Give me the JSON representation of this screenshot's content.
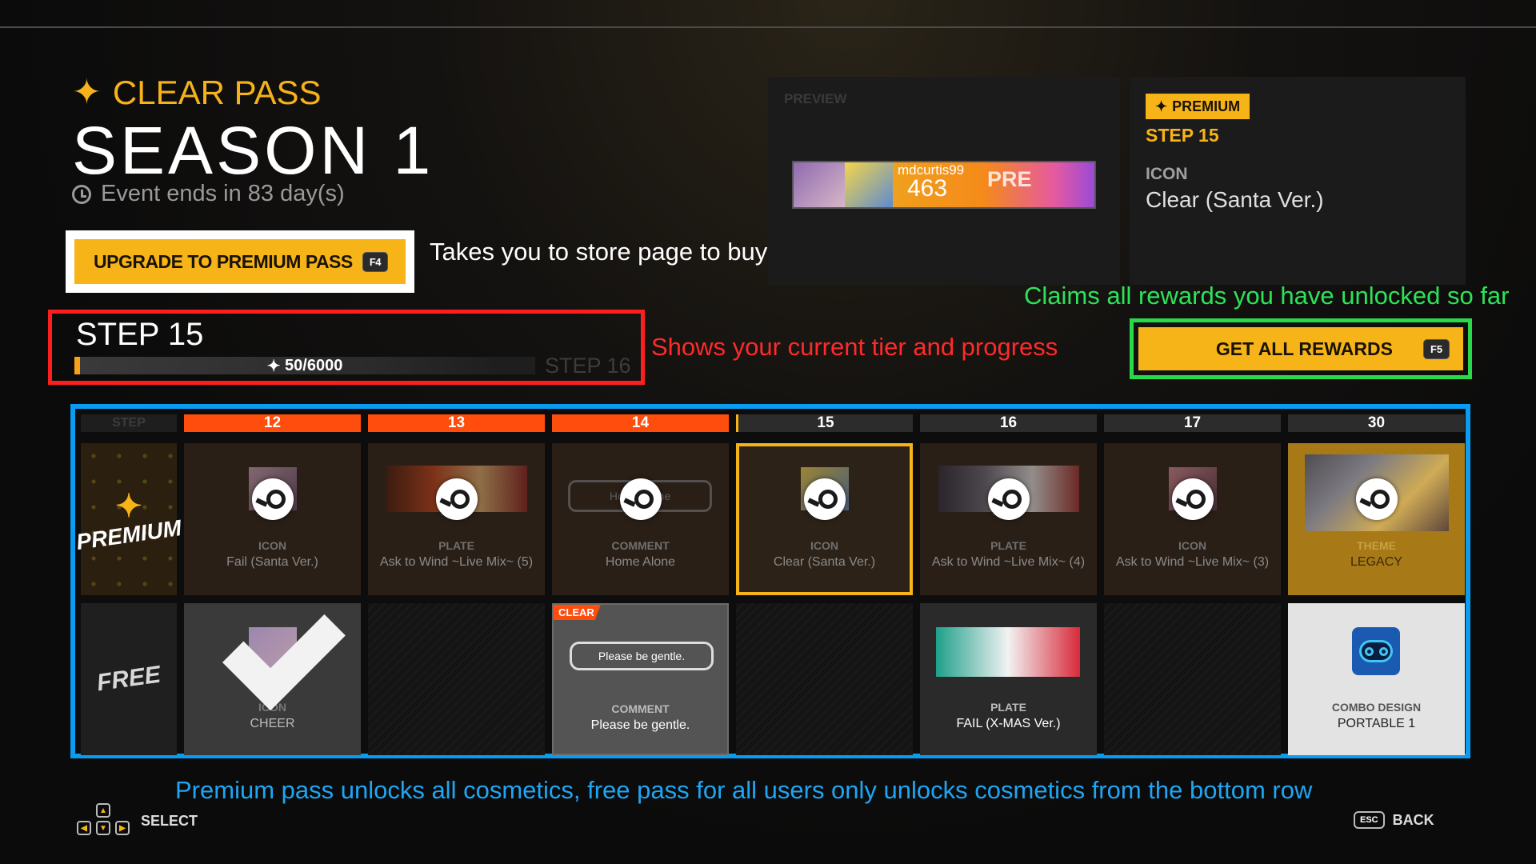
{
  "header": {
    "pass_label": "CLEAR PASS",
    "season_title": "SEASON 1",
    "event_ends": "Event ends in 83 day(s)"
  },
  "upgrade": {
    "label": "UPGRADE TO PREMIUM PASS",
    "key": "F4"
  },
  "annotations": {
    "upgrade_note": "Takes you to store page to buy premium pass",
    "progress_note": "Shows your current tier and progress",
    "rewards_note": "Claims all rewards you have unlocked so far",
    "grid_note": "Premium pass unlocks all cosmetics, free pass for all users only unlocks cosmetics from the bottom row"
  },
  "progress": {
    "current_step": "STEP 15",
    "next_step": "STEP 16",
    "text": "50/6000",
    "value": 50,
    "max": 6000
  },
  "preview": {
    "label": "PREVIEW",
    "plate_user": "mdcurtis99",
    "plate_number": "463",
    "plate_word": "PRE"
  },
  "detail": {
    "tag": "PREMIUM",
    "step": "STEP 15",
    "type": "ICON",
    "name": "Clear (Santa Ver.)"
  },
  "get_rewards": {
    "label": "GET ALL REWARDS",
    "key": "F5"
  },
  "grid": {
    "step_header": "STEP",
    "premium_label": "PREMIUM",
    "free_label": "FREE",
    "columns": [
      {
        "step": "12",
        "premium": {
          "type": "ICON",
          "name": "Fail (Santa Ver.)"
        },
        "free": {
          "type": "ICON",
          "name": "CHEER",
          "claimed": true
        }
      },
      {
        "step": "13",
        "premium": {
          "type": "PLATE",
          "name": "Ask to Wind ~Live Mix~ (5)"
        },
        "free": null
      },
      {
        "step": "14",
        "premium": {
          "type": "COMMENT",
          "name": "Home Alone",
          "bubble": "Home Alone"
        },
        "free": {
          "type": "COMMENT",
          "name": "Please be gentle.",
          "bubble": "Please be gentle.",
          "tag": "CLEAR"
        }
      },
      {
        "step": "15",
        "premium": {
          "type": "ICON",
          "name": "Clear (Santa Ver.)"
        },
        "free": null
      },
      {
        "step": "16",
        "premium": {
          "type": "PLATE",
          "name": "Ask to Wind ~Live Mix~ (4)"
        },
        "free": {
          "type": "PLATE",
          "name": "FAIL (X-MAS Ver.)"
        }
      },
      {
        "step": "17",
        "premium": {
          "type": "ICON",
          "name": "Ask to Wind ~Live Mix~ (3)"
        },
        "free": null
      },
      {
        "step": "30",
        "premium": {
          "type": "THEME",
          "name": "LEGACY"
        },
        "free": {
          "type": "COMBO DESIGN",
          "name": "PORTABLE 1"
        }
      }
    ]
  },
  "footer": {
    "select": "SELECT",
    "back": "BACK",
    "esc": "ESC"
  }
}
